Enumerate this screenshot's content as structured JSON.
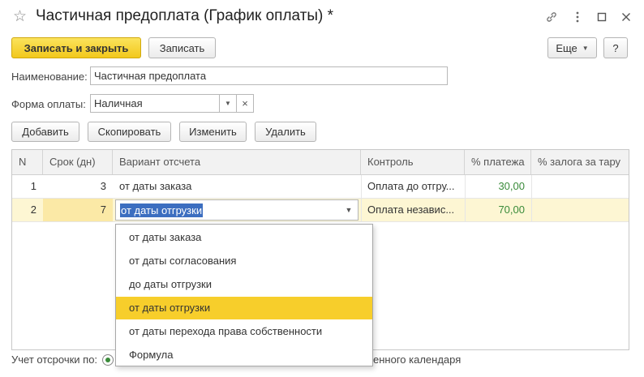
{
  "window": {
    "title": "Частичная предоплата (График оплаты) *",
    "star_icon": "☆"
  },
  "toolbar": {
    "save_close_label": "Записать и закрыть",
    "save_label": "Записать",
    "more_label": "Еще",
    "help_label": "?"
  },
  "form": {
    "name_label": "Наименование:",
    "name_value": "Частичная предоплата",
    "payment_form_label": "Форма оплаты:",
    "payment_form_value": "Наличная"
  },
  "table_toolbar": {
    "add_label": "Добавить",
    "copy_label": "Скопировать",
    "edit_label": "Изменить",
    "delete_label": "Удалить"
  },
  "table": {
    "columns": [
      "N",
      "Срок (дн)",
      "Вариант отсчета",
      "Контроль",
      "% платежа",
      "% залога за тару"
    ],
    "rows": [
      {
        "n": "1",
        "term": "3",
        "variant": "от даты заказа",
        "control": "Оплата до отгру...",
        "payment_pct": "30,00",
        "deposit_pct": ""
      },
      {
        "n": "2",
        "term": "7",
        "variant": "от даты отгрузки",
        "control": "Оплата независ...",
        "payment_pct": "70,00",
        "deposit_pct": ""
      }
    ]
  },
  "dropdown": {
    "options": [
      "от даты заказа",
      "от даты согласования",
      "до даты отгрузки",
      "от даты отгрузки",
      "от даты перехода права собственности",
      "Формула"
    ],
    "selected": "от даты отгрузки"
  },
  "footer": {
    "deferral_label": "Учет отсрочки по:",
    "calendar_text": "енного календаря"
  },
  "colors": {
    "primary_button": "#f2c81c",
    "selected_row": "#fdf6d3",
    "selected_option": "#f7ce2b",
    "percent_text": "#3a8b3a",
    "edit_highlight": "#3c6ec0"
  }
}
